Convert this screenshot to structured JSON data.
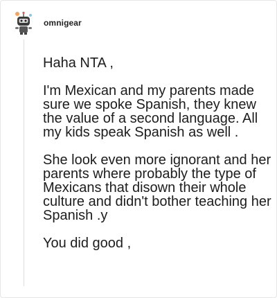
{
  "comment": {
    "username": "omnigear",
    "paragraphs": [
      "Haha NTA ,",
      "I'm Mexican and my parents made sure we spoke Spanish, they knew the value of a second language. All my kids speak Spanish as well .",
      "She look even more ignorant and her parents where probably the type of Mexicans that disown their whole culture and didn't bother teaching her Spanish .y",
      "You did good ,"
    ]
  },
  "colors": {
    "text": "#1c1c1c",
    "border": "#e6e6e6",
    "thread_line": "#dddddd"
  },
  "icons": {
    "avatar": "robot-avatar-icon"
  }
}
